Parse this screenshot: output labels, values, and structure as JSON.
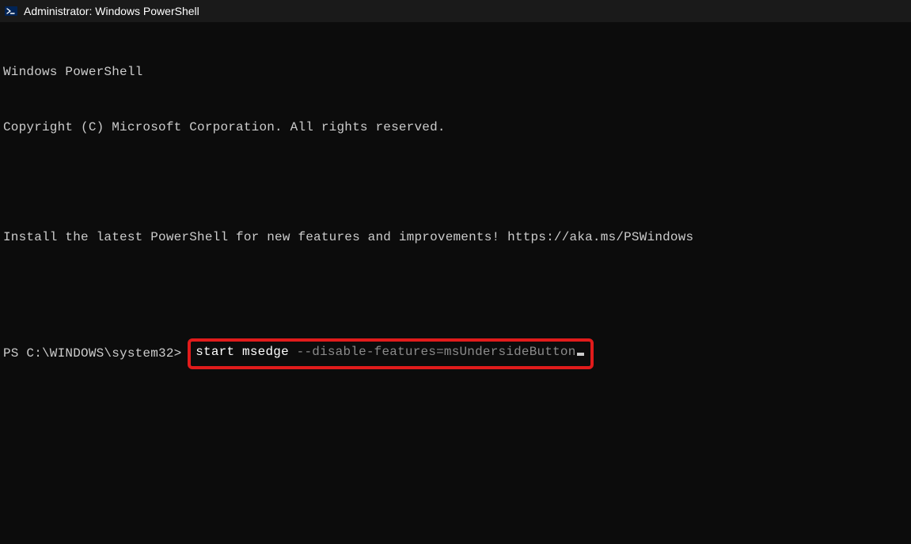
{
  "window": {
    "title": "Administrator: Windows PowerShell"
  },
  "terminal": {
    "line1": "Windows PowerShell",
    "line2": "Copyright (C) Microsoft Corporation. All rights reserved.",
    "line3": "Install the latest PowerShell for new features and improvements! https://aka.ms/PSWindows",
    "prompt": "PS C:\\WINDOWS\\system32> ",
    "cmd_part1": "start msedge ",
    "cmd_part2": "--disable-features=msUndersideButton"
  },
  "annotation": {
    "highlight_color": "#e11b1b"
  }
}
